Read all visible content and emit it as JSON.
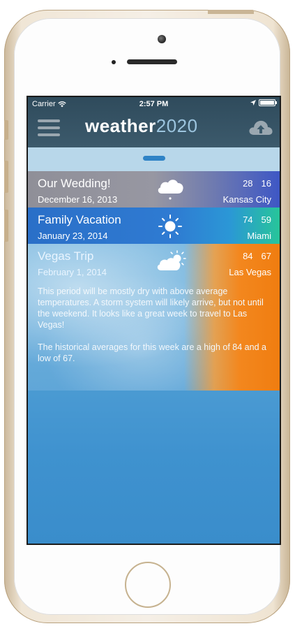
{
  "status_bar": {
    "carrier": "Carrier",
    "time": "2:57 PM"
  },
  "app": {
    "logo_part1": "weather",
    "logo_part2": "2020"
  },
  "events": [
    {
      "name": "Our Wedding!",
      "date": "December 16, 2013",
      "high": "28",
      "low": "16",
      "city": "Kansas City",
      "icon": "snow-cloud-icon"
    },
    {
      "name": "Family Vacation",
      "date": "January 23, 2014",
      "high": "74",
      "low": "59",
      "city": "Miami",
      "icon": "sun-icon"
    },
    {
      "name": "Vegas Trip",
      "date": "February 1, 2014",
      "high": "84",
      "low": "67",
      "city": "Las Vegas",
      "icon": "partly-cloudy-icon",
      "description": [
        "This period will be mostly dry with above average temperatures. A storm system will likely arrive, but not until the weekend. It looks like a great week to travel to Las Vegas!",
        "The historical averages for this week are a high of 84 and a low of 67."
      ]
    }
  ],
  "colors": {
    "nav_bar": "#2f4b5c",
    "accent": "#2f83c6",
    "warm": "#f07d10"
  }
}
